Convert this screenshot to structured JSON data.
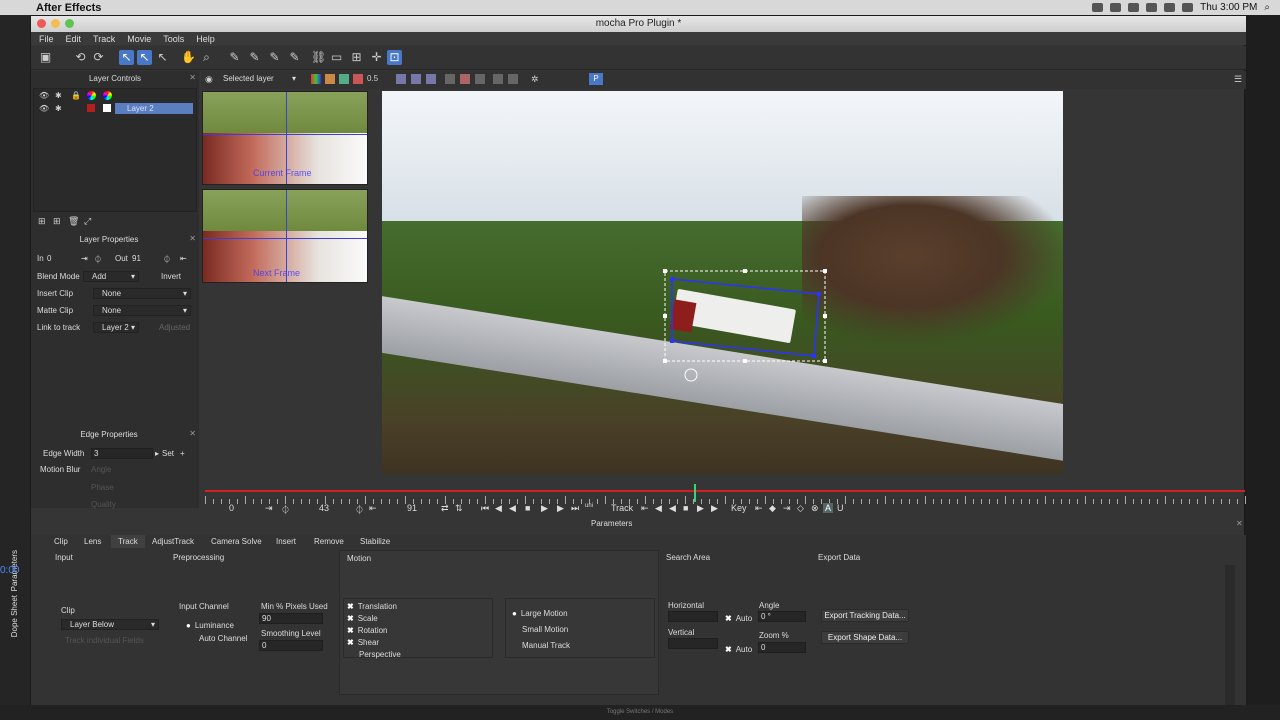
{
  "macmenu": {
    "apple": "",
    "app": "After Effects",
    "clock": "Thu 3:00 PM"
  },
  "window": {
    "title": "mocha Pro Plugin *"
  },
  "menu": [
    "File",
    "Edit",
    "Track",
    "Movie",
    "Tools",
    "Help"
  ],
  "left": {
    "layer_controls": "Layer Controls",
    "layer_name": "Layer 2",
    "layer_properties": "Layer Properties",
    "in_label": "In",
    "in_value": "0",
    "out_label": "Out",
    "out_value": "91",
    "blend_mode_label": "Blend Mode",
    "blend_mode_value": "Add",
    "invert_label": "Invert",
    "insert_clip_label": "Insert Clip",
    "insert_clip_value": "None",
    "matte_clip_label": "Matte Clip",
    "matte_clip_value": "None",
    "link_label": "Link to track",
    "link_value": "Layer 2",
    "adjusted_label": "Adjusted",
    "edge_properties": "Edge Properties",
    "edge_width_label": "Edge Width",
    "edge_width_value": "3",
    "set_label": "Set",
    "motion_blur_label": "Motion Blur",
    "angle_label": "Angle",
    "phase_label": "Phase",
    "quality_label": "Quality"
  },
  "viewer_toolbar": {
    "layer_select": "Selected layer",
    "zoom": "0.5",
    "p_button": "P"
  },
  "thumbs": {
    "top_label": "Current Frame",
    "bottom_label": "Next Frame"
  },
  "timeline": {
    "start": "0",
    "current": "43",
    "end": "91",
    "track_label": "Track",
    "key_label": "Key",
    "playhead": 0.47
  },
  "params": {
    "header": "Parameters",
    "tabs": [
      "Clip",
      "Lens",
      "Track",
      "AdjustTrack",
      "Camera Solve",
      "Insert",
      "Remove",
      "Stabilize"
    ],
    "active_tab": "Track",
    "side_tabs": [
      "Parameters",
      "Dope Sheet"
    ],
    "timecode": "0:00",
    "input": "Input",
    "clip": "Clip",
    "clip_value": "Layer Below",
    "track_individual": "Track individual Fields",
    "preprocessing": "Preprocessing",
    "input_channel": "Input Channel",
    "luminance": "Luminance",
    "auto_channel": "Auto Channel",
    "min_pixels": "Min % Pixels Used",
    "min_pixels_value": "90",
    "smoothing": "Smoothing Level",
    "smoothing_value": "0",
    "motion": "Motion",
    "translation": "Translation",
    "scale": "Scale",
    "rotation": "Rotation",
    "shear": "Shear",
    "perspective": "Perspective",
    "large_motion": "Large Motion",
    "small_motion": "Small Motion",
    "manual_track": "Manual Track",
    "search_area": "Search Area",
    "horizontal": "Horizontal",
    "vertical": "Vertical",
    "auto1": "Auto",
    "auto2": "Auto",
    "angle": "Angle",
    "angle_value": "0 °",
    "zoom": "Zoom %",
    "zoom_value": "0",
    "export_data": "Export Data",
    "export_tracking": "Export Tracking Data...",
    "export_shape": "Export Shape Data..."
  },
  "footer": {
    "toggle": "Toggle Switches / Modes"
  }
}
